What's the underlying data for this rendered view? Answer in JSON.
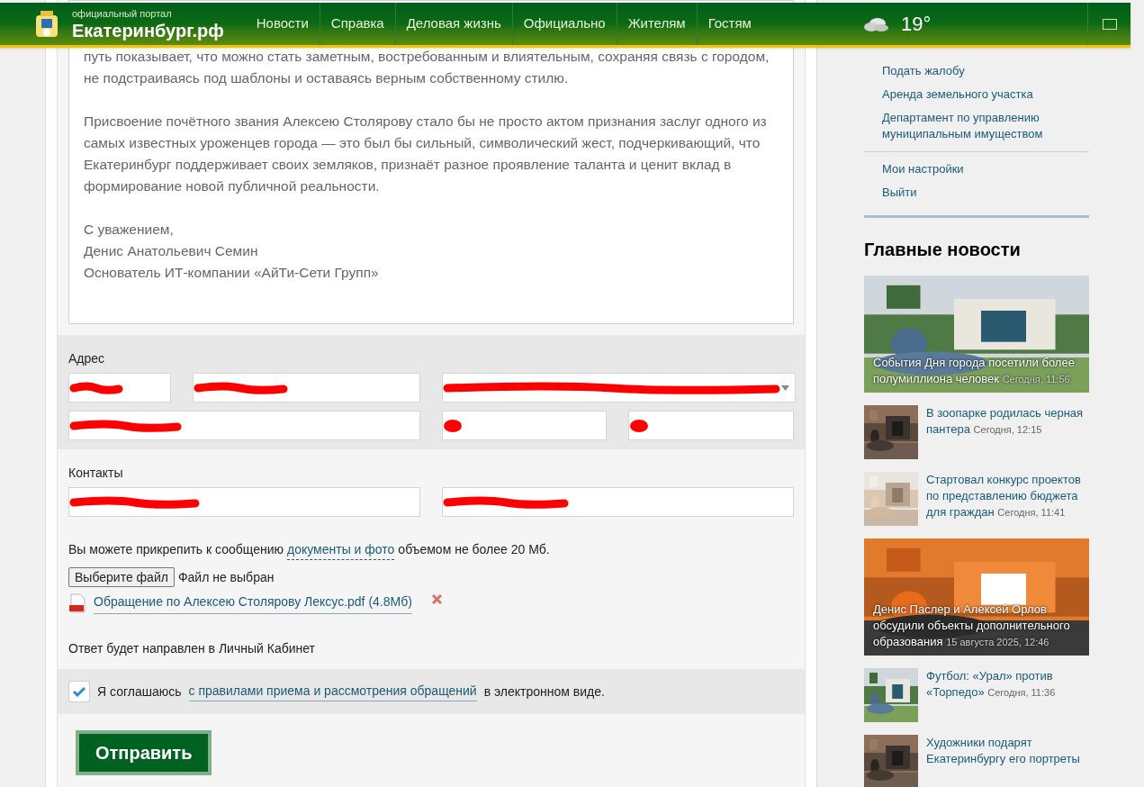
{
  "header": {
    "subtitle": "официальный портал",
    "site_name": "Екатеринбург.рф",
    "nav": [
      {
        "label": "Новости"
      },
      {
        "label": "Справка"
      },
      {
        "label": "Деловая жизнь"
      },
      {
        "label": "Официально"
      },
      {
        "label": "Жителям"
      },
      {
        "label": "Гостям"
      }
    ],
    "temperature": "19°"
  },
  "letter": {
    "paragraphs": [
      "путь показывает, что можно стать заметным, востребованным и влиятельным, сохраняя связь с городом, не подстраиваясь под шаблоны и оставаясь верным собственному стилю.",
      "Присвоение почётного звания Алексею Столярову стало бы не просто актом признания заслуг одного из самых известных уроженцев города — это был бы сильный, символический жест, подчеркивающий, что Екатеринбург поддерживает своих земляков, признаёт разное проявление таланта и ценит вклад в формирование новой публичной реальности.",
      "С уважением,\nДенис Анатольевич Семин\nОснователь ИТ-компании «АйТи-Сети Групп»"
    ]
  },
  "address": {
    "label": "Адрес",
    "fields": [
      {
        "kind": "input"
      },
      {
        "kind": "input"
      },
      {
        "kind": "select"
      },
      {
        "kind": "input"
      },
      {
        "kind": "input"
      },
      {
        "kind": "input"
      }
    ]
  },
  "contacts": {
    "label": "Контакты",
    "fields": [
      {
        "kind": "input"
      },
      {
        "kind": "input"
      }
    ]
  },
  "attachments": {
    "note_before": "Вы можете прикрепить к сообщению",
    "note_link": "документы и фото",
    "note_after": "объемом не более 20 Мб.",
    "choose_button": "Выберите файл",
    "no_file": "Файл не выбран",
    "files": [
      {
        "name": "Обращение по Алексею Столярову Лексус.pdf (4.8Мб)"
      }
    ]
  },
  "answer_note": "Ответ будет направлен в Личный Кабинет",
  "agreement": {
    "checked": true,
    "before": "Я соглашаюсь",
    "link": "с правилами приема и рассмотрения обращений",
    "after": "в электронном виде."
  },
  "submit": "Отправить",
  "sidebar": {
    "link_groups": [
      [
        {
          "label": "Подать жалобу"
        },
        {
          "label": "Аренда земельного участка"
        },
        {
          "label": "Департамент по управлению муниципальным имуществом"
        }
      ],
      [
        {
          "label": "Мои настройки"
        },
        {
          "label": "Выйти"
        }
      ]
    ],
    "news_title": "Главные новости",
    "news": [
      {
        "kind": "big",
        "title": "События Дня города посетили более полумиллиона человек",
        "time": "Сегодня, 11:56"
      },
      {
        "kind": "small",
        "title": "В зоопарке родилась черная пантера",
        "time": "Сегодня, 12:15"
      },
      {
        "kind": "small",
        "title": "Стартовал конкурс проектов по представлению бюджета для граждан",
        "time": "Сегодня, 11:41"
      },
      {
        "kind": "big",
        "title": "Денис Паслер и Алексей Орлов обсудили объекты дополнительного образования",
        "time": "15 августа 2025, 12:46"
      },
      {
        "kind": "small",
        "title": "Футбол: «Урал» против «Торпедо»",
        "time": "Сегодня, 11:36"
      },
      {
        "kind": "small",
        "title": "Художники подарят Екатеринбургу его портреты"
      }
    ]
  }
}
